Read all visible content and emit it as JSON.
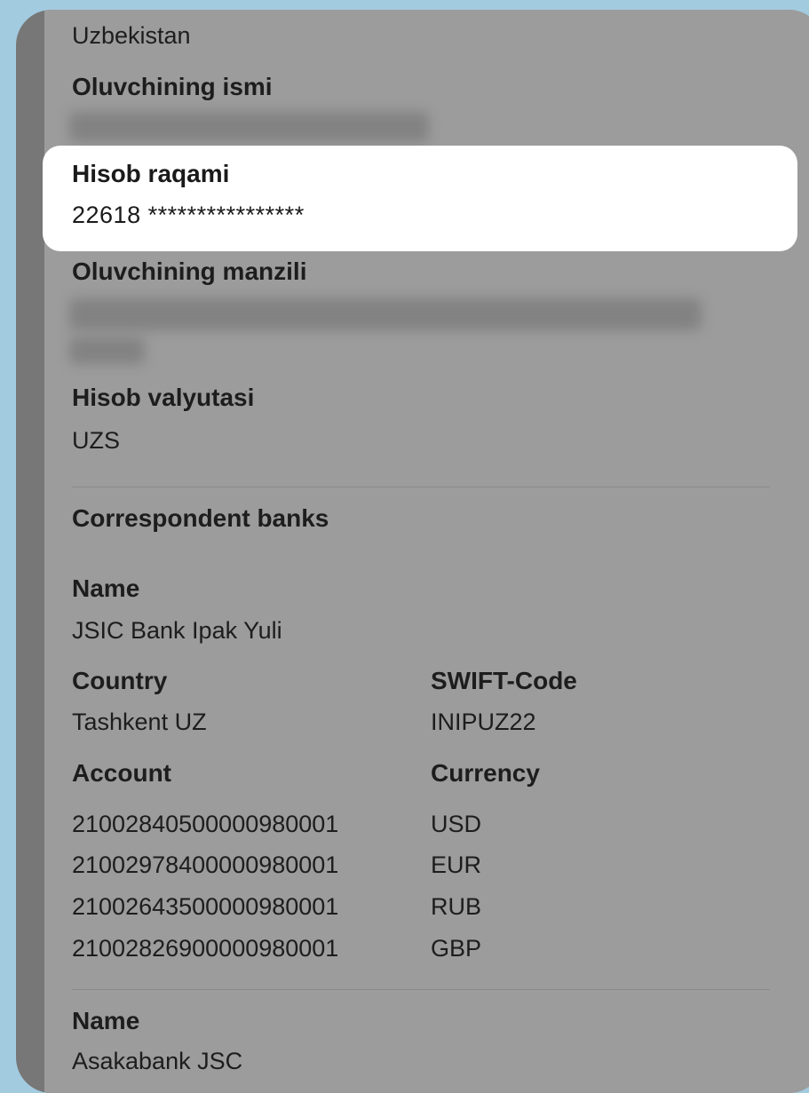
{
  "recipient": {
    "country_value": "Uzbekistan",
    "name_label": "Oluvchining ismi",
    "account_label": "Hisob raqami",
    "account_value": "22618 ****************",
    "address_label": "Oluvchining manzili",
    "currency_label": "Hisob valyutasi",
    "currency_value": "UZS"
  },
  "correspondent": {
    "section_title": "Correspondent banks",
    "name_label": "Name",
    "bank1": {
      "name": "JSIC Bank Ipak Yuli",
      "country_label": "Country",
      "country_value": "Tashkent UZ",
      "swift_label": "SWIFT-Code",
      "swift_value": "INIPUZ22",
      "account_label": "Account",
      "currency_label": "Currency",
      "rows": [
        {
          "account": "21002840500000980001",
          "currency": "USD"
        },
        {
          "account": "21002978400000980001",
          "currency": "EUR"
        },
        {
          "account": "21002643500000980001",
          "currency": "RUB"
        },
        {
          "account": "21002826900000980001",
          "currency": "GBP"
        }
      ]
    },
    "bank2": {
      "name_label": "Name",
      "name": "Asakabank JSC"
    }
  }
}
